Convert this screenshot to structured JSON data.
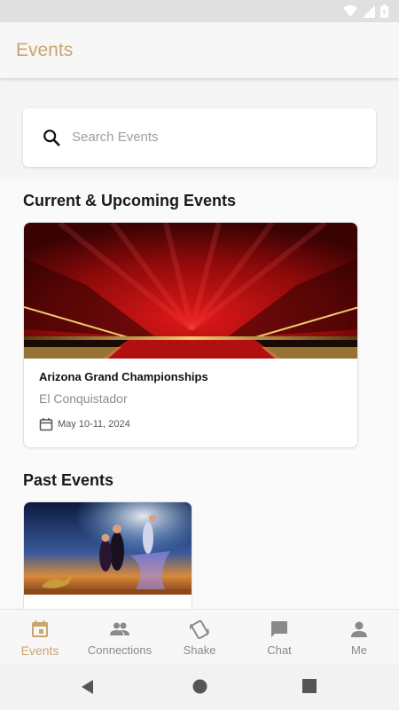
{
  "colors": {
    "accent": "#c8a66e",
    "inactive": "#8a8a8a"
  },
  "app_bar": {
    "title": "Events"
  },
  "search": {
    "placeholder": "Search Events",
    "icon": "search-icon"
  },
  "sections": {
    "current": "Current & Upcoming Events",
    "past": "Past Events"
  },
  "current_events": [
    {
      "name": "Arizona Grand Championships",
      "venue": "El Conquistador",
      "date": "May 10-11, 2024"
    }
  ],
  "bottom_nav": [
    {
      "label": "Events",
      "icon": "calendar-icon",
      "active": true
    },
    {
      "label": "Connections",
      "icon": "people-icon",
      "active": false
    },
    {
      "label": "Shake",
      "icon": "shake-icon",
      "active": false
    },
    {
      "label": "Chat",
      "icon": "chat-icon",
      "active": false
    },
    {
      "label": "Me",
      "icon": "person-icon",
      "active": false
    }
  ]
}
